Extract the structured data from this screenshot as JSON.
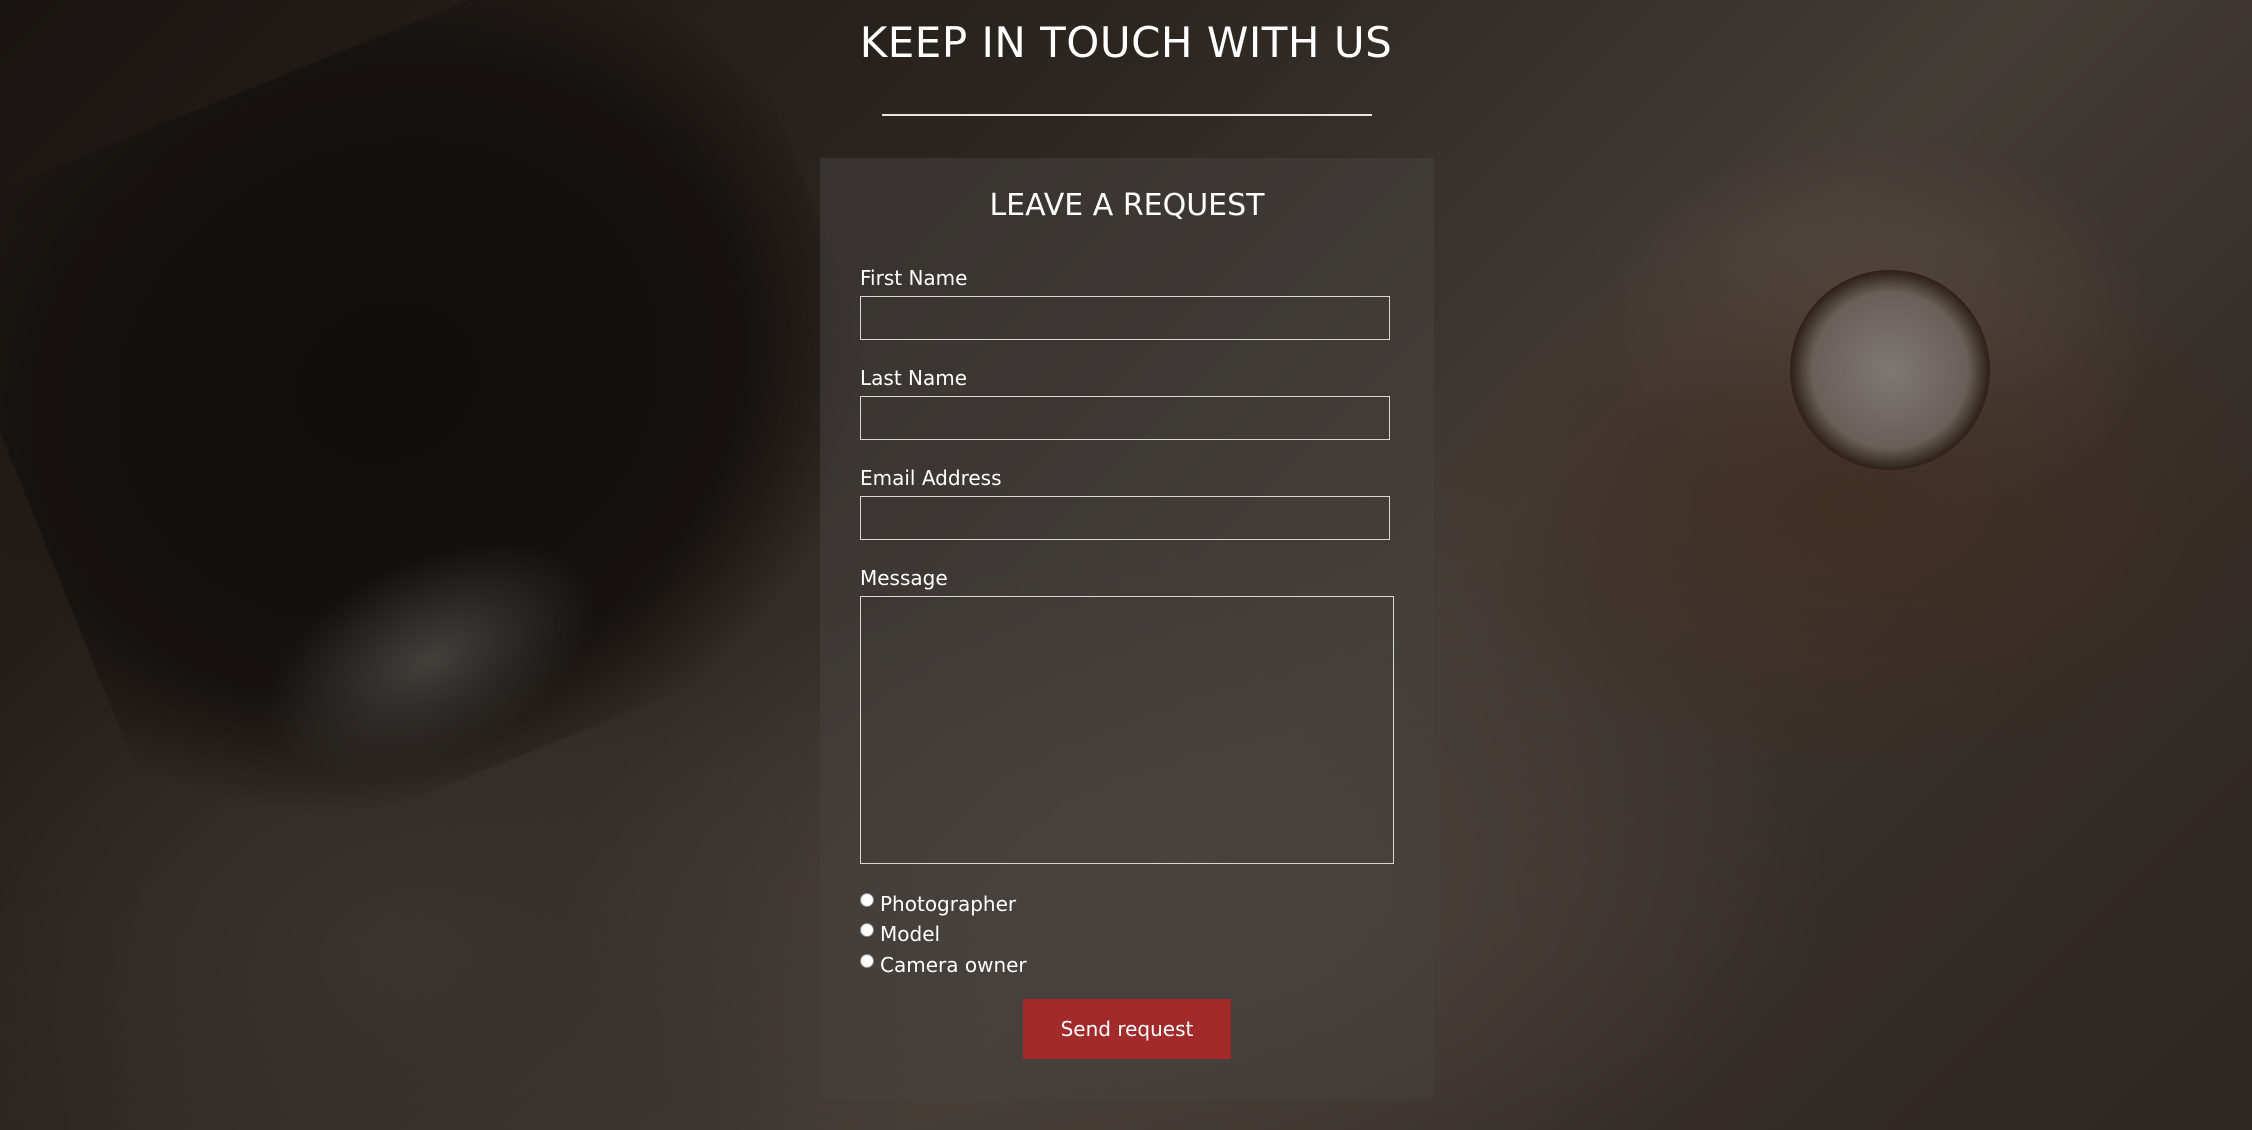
{
  "page": {
    "heading": "KEEP IN TOUCH WITH US"
  },
  "form": {
    "title": "LEAVE A REQUEST",
    "fields": {
      "first_name": {
        "label": "First Name",
        "value": ""
      },
      "last_name": {
        "label": "Last Name",
        "value": ""
      },
      "email": {
        "label": "Email Address",
        "value": ""
      },
      "message": {
        "label": "Message",
        "value": ""
      }
    },
    "roles": [
      {
        "label": "Photographer",
        "selected": false
      },
      {
        "label": "Model",
        "selected": false
      },
      {
        "label": "Camera owner",
        "selected": false
      }
    ],
    "submit_label": "Send request"
  },
  "colors": {
    "button": "#a32a2b",
    "text": "#ffffff",
    "panel": "#46423f"
  }
}
